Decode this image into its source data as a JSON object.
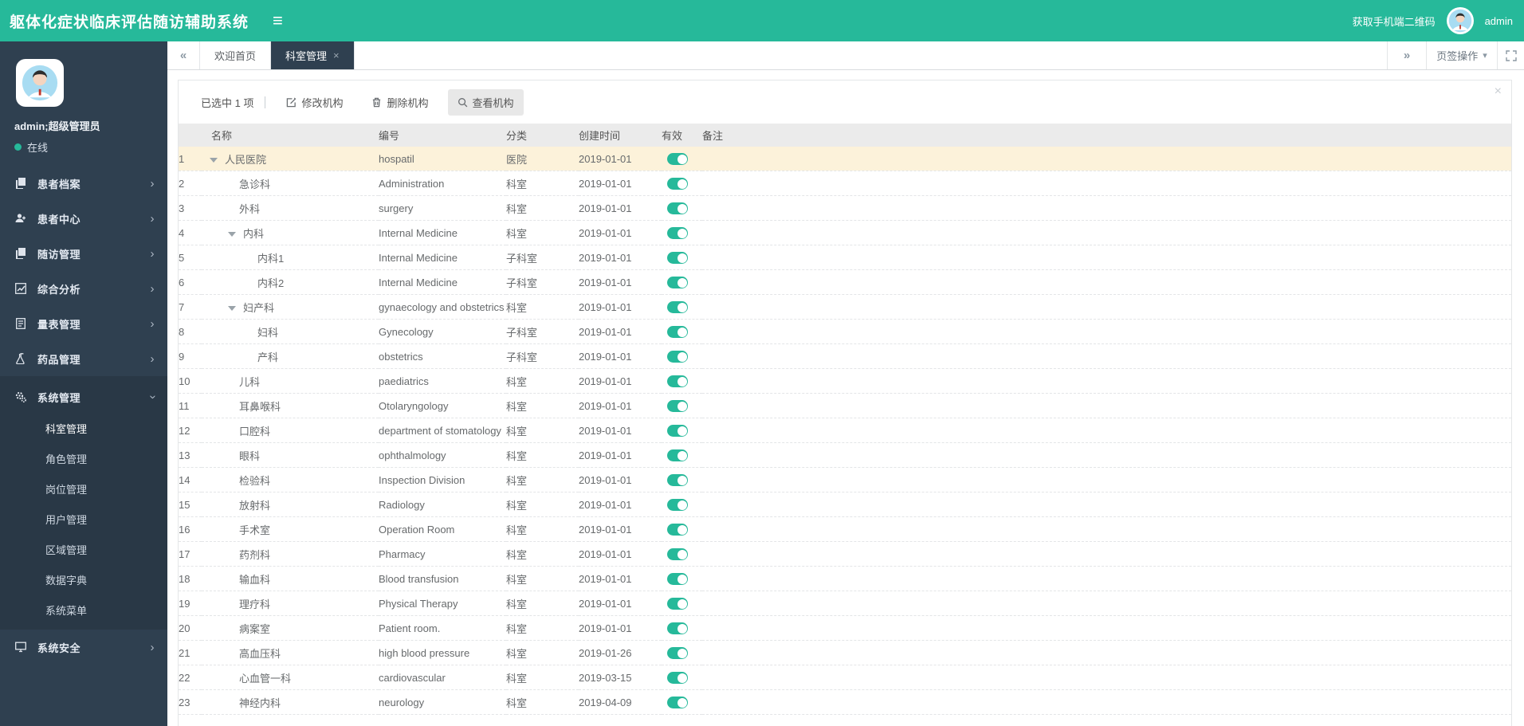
{
  "header": {
    "title": "躯体化症状临床评估随访辅助系统",
    "qr_link": "获取手机端二维码",
    "username": "admin"
  },
  "sidebar": {
    "user_name": "admin;超级管理员",
    "user_status": "在线",
    "menu": [
      {
        "label": "患者档案",
        "icon": "documents-icon"
      },
      {
        "label": "患者中心",
        "icon": "user-plus-icon"
      },
      {
        "label": "随访管理",
        "icon": "documents-icon"
      },
      {
        "label": "综合分析",
        "icon": "line-chart-icon"
      },
      {
        "label": "量表管理",
        "icon": "file-text-icon"
      },
      {
        "label": "药品管理",
        "icon": "flask-icon"
      },
      {
        "label": "系统管理",
        "icon": "gears-icon",
        "expanded": true,
        "children": [
          {
            "label": "科室管理",
            "active": true
          },
          {
            "label": "角色管理"
          },
          {
            "label": "岗位管理"
          },
          {
            "label": "用户管理"
          },
          {
            "label": "区域管理"
          },
          {
            "label": "数据字典"
          },
          {
            "label": "系统菜单"
          }
        ]
      },
      {
        "label": "系统安全",
        "icon": "desktop-icon"
      }
    ]
  },
  "tabbar": {
    "tabs": [
      {
        "label": "欢迎首页",
        "active": false
      },
      {
        "label": "科室管理",
        "active": true,
        "closable": true
      }
    ],
    "actions_label": "页签操作"
  },
  "toolbar": {
    "selected_info": "已选中 1 项",
    "edit_button": "修改机构",
    "delete_button": "删除机构",
    "view_button": "查看机构"
  },
  "table": {
    "columns": [
      "名称",
      "编号",
      "分类",
      "创建时间",
      "有效",
      "备注"
    ],
    "rows": [
      {
        "num": 1,
        "name": "人民医院",
        "indent": 0,
        "toggle": true,
        "code": "hospatil",
        "category": "医院",
        "created": "2019-01-01",
        "active": true,
        "selected": true
      },
      {
        "num": 2,
        "name": "急诊科",
        "indent": 1,
        "toggle": false,
        "code": "Administration",
        "category": "科室",
        "created": "2019-01-01",
        "active": true
      },
      {
        "num": 3,
        "name": "外科",
        "indent": 1,
        "toggle": false,
        "code": "surgery",
        "category": "科室",
        "created": "2019-01-01",
        "active": true
      },
      {
        "num": 4,
        "name": "内科",
        "indent": 1,
        "toggle": true,
        "code": "Internal Medicine",
        "category": "科室",
        "created": "2019-01-01",
        "active": true
      },
      {
        "num": 5,
        "name": "内科1",
        "indent": 2,
        "toggle": false,
        "code": "Internal Medicine",
        "category": "子科室",
        "created": "2019-01-01",
        "active": true
      },
      {
        "num": 6,
        "name": "内科2",
        "indent": 2,
        "toggle": false,
        "code": "Internal Medicine",
        "category": "子科室",
        "created": "2019-01-01",
        "active": true
      },
      {
        "num": 7,
        "name": "妇产科",
        "indent": 1,
        "toggle": true,
        "code": "gynaecology and obstetrics",
        "category": "科室",
        "created": "2019-01-01",
        "active": true
      },
      {
        "num": 8,
        "name": "妇科",
        "indent": 2,
        "toggle": false,
        "code": "Gynecology",
        "category": "子科室",
        "created": "2019-01-01",
        "active": true
      },
      {
        "num": 9,
        "name": "产科",
        "indent": 2,
        "toggle": false,
        "code": "obstetrics",
        "category": "子科室",
        "created": "2019-01-01",
        "active": true
      },
      {
        "num": 10,
        "name": "儿科",
        "indent": 1,
        "toggle": false,
        "code": "paediatrics",
        "category": "科室",
        "created": "2019-01-01",
        "active": true
      },
      {
        "num": 11,
        "name": "耳鼻喉科",
        "indent": 1,
        "toggle": false,
        "code": "Otolaryngology",
        "category": "科室",
        "created": "2019-01-01",
        "active": true
      },
      {
        "num": 12,
        "name": "口腔科",
        "indent": 1,
        "toggle": false,
        "code": "department of stomatology",
        "category": "科室",
        "created": "2019-01-01",
        "active": true
      },
      {
        "num": 13,
        "name": "眼科",
        "indent": 1,
        "toggle": false,
        "code": "ophthalmology",
        "category": "科室",
        "created": "2019-01-01",
        "active": true
      },
      {
        "num": 14,
        "name": "检验科",
        "indent": 1,
        "toggle": false,
        "code": "Inspection Division",
        "category": "科室",
        "created": "2019-01-01",
        "active": true
      },
      {
        "num": 15,
        "name": "放射科",
        "indent": 1,
        "toggle": false,
        "code": "Radiology",
        "category": "科室",
        "created": "2019-01-01",
        "active": true
      },
      {
        "num": 16,
        "name": "手术室",
        "indent": 1,
        "toggle": false,
        "code": " Operation Room",
        "category": "科室",
        "created": "2019-01-01",
        "active": true
      },
      {
        "num": 17,
        "name": "药剂科",
        "indent": 1,
        "toggle": false,
        "code": "Pharmacy",
        "category": "科室",
        "created": "2019-01-01",
        "active": true
      },
      {
        "num": 18,
        "name": "输血科",
        "indent": 1,
        "toggle": false,
        "code": "Blood transfusion",
        "category": "科室",
        "created": "2019-01-01",
        "active": true
      },
      {
        "num": 19,
        "name": "理疗科",
        "indent": 1,
        "toggle": false,
        "code": "Physical Therapy",
        "category": "科室",
        "created": "2019-01-01",
        "active": true
      },
      {
        "num": 20,
        "name": "病案室",
        "indent": 1,
        "toggle": false,
        "code": "Patient room.",
        "category": "科室",
        "created": "2019-01-01",
        "active": true
      },
      {
        "num": 21,
        "name": "高血压科",
        "indent": 1,
        "toggle": false,
        "code": "high blood pressure",
        "category": "科室",
        "created": "2019-01-26",
        "active": true
      },
      {
        "num": 22,
        "name": "心血管一科",
        "indent": 1,
        "toggle": false,
        "code": "cardiovascular",
        "category": "科室",
        "created": "2019-03-15",
        "active": true
      },
      {
        "num": 23,
        "name": "神经内科",
        "indent": 1,
        "toggle": false,
        "code": "neurology",
        "category": "科室",
        "created": "2019-04-09",
        "active": true
      }
    ]
  },
  "colors": {
    "accent": "#26b99a",
    "sidebar": "#2f4050",
    "sidebar_expanded": "#293846",
    "selected_row": "#fcf2da",
    "active_tab": "#2f4050"
  }
}
